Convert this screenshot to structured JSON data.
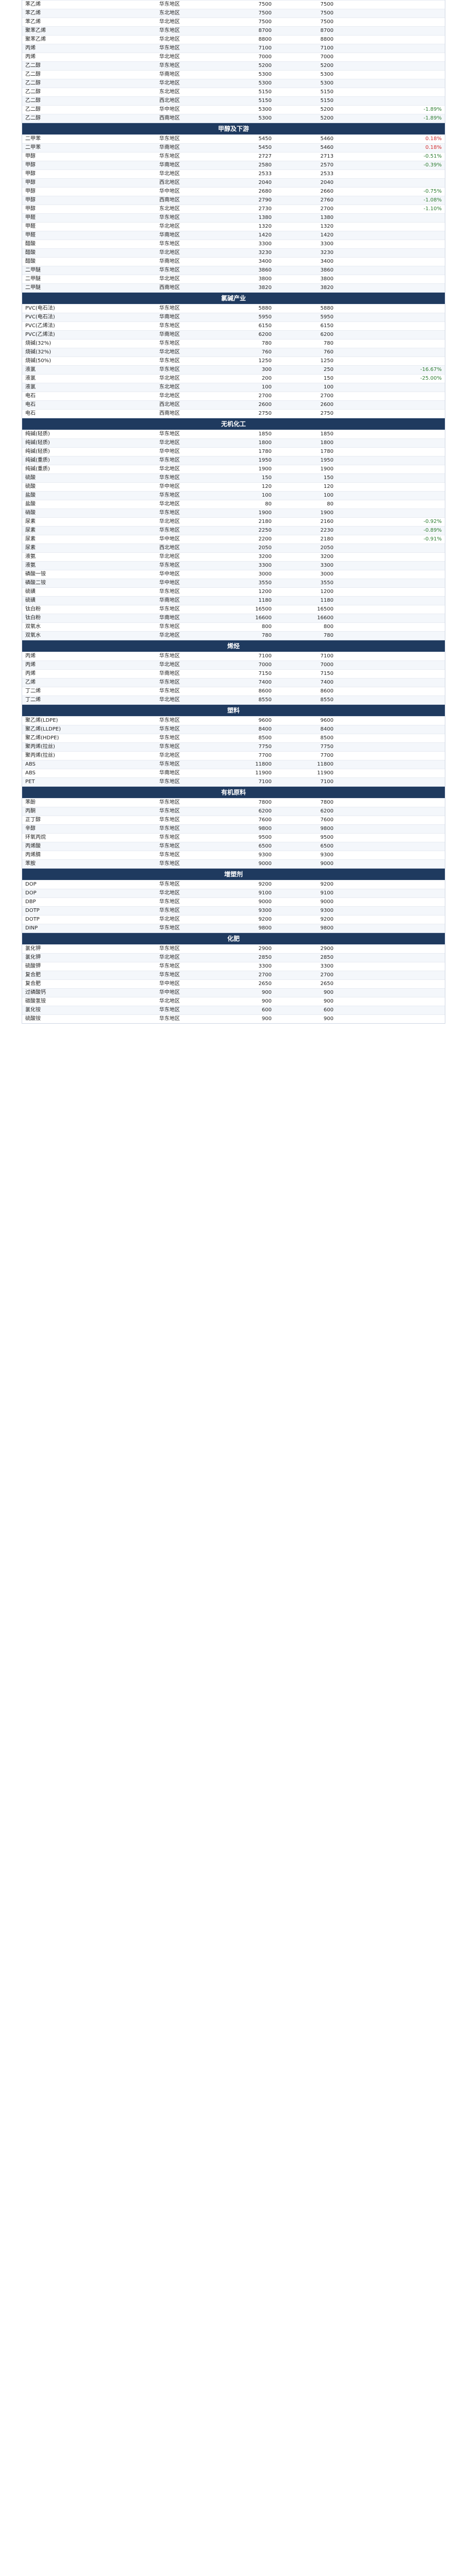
{
  "sections": [
    {
      "title": "",
      "rows": [
        [
          "苯乙烯",
          "华东地区",
          "7500",
          "7500",
          ""
        ],
        [
          "苯乙烯",
          "东北地区",
          "7500",
          "7500",
          ""
        ],
        [
          "苯乙烯",
          "华北地区",
          "7500",
          "7500",
          ""
        ],
        [
          "聚苯乙烯",
          "华东地区",
          "8700",
          "8700",
          ""
        ],
        [
          "聚苯乙烯",
          "华北地区",
          "8800",
          "8800",
          ""
        ],
        [
          "丙烯",
          "华东地区",
          "7100",
          "7100",
          ""
        ],
        [
          "丙烯",
          "华北地区",
          "7000",
          "7000",
          ""
        ],
        [
          "乙二醇",
          "华东地区",
          "5200",
          "5200",
          ""
        ],
        [
          "乙二醇",
          "华南地区",
          "5300",
          "5300",
          ""
        ],
        [
          "乙二醇",
          "华北地区",
          "5300",
          "5300",
          ""
        ],
        [
          "乙二醇",
          "东北地区",
          "5150",
          "5150",
          ""
        ],
        [
          "乙二醇",
          "西北地区",
          "5150",
          "5150",
          ""
        ],
        [
          "乙二醇",
          "华中地区",
          "5300",
          "5200",
          "-1.89%"
        ],
        [
          "乙二醇",
          "西南地区",
          "5300",
          "5200",
          "-1.89%"
        ]
      ]
    },
    {
      "title": "甲醇及下游",
      "rows": [
        [
          "二甲苯",
          "华东地区",
          "5450",
          "5460",
          "0.18%"
        ],
        [
          "二甲苯",
          "华南地区",
          "5450",
          "5460",
          "0.18%"
        ],
        [
          "甲醇",
          "华东地区",
          "2727",
          "2713",
          "-0.51%"
        ],
        [
          "甲醇",
          "华南地区",
          "2580",
          "2570",
          "-0.39%"
        ],
        [
          "甲醇",
          "华北地区",
          "2533",
          "2533",
          ""
        ],
        [
          "甲醇",
          "西北地区",
          "2040",
          "2040",
          ""
        ],
        [
          "甲醇",
          "华中地区",
          "2680",
          "2660",
          "-0.75%"
        ],
        [
          "甲醇",
          "西南地区",
          "2790",
          "2760",
          "-1.08%"
        ],
        [
          "甲醇",
          "东北地区",
          "2730",
          "2700",
          "-1.10%"
        ],
        [
          "甲醛",
          "华东地区",
          "1380",
          "1380",
          ""
        ],
        [
          "甲醛",
          "华北地区",
          "1320",
          "1320",
          ""
        ],
        [
          "甲醛",
          "华南地区",
          "1420",
          "1420",
          ""
        ],
        [
          "醋酸",
          "华东地区",
          "3300",
          "3300",
          ""
        ],
        [
          "醋酸",
          "华北地区",
          "3230",
          "3230",
          ""
        ],
        [
          "醋酸",
          "华南地区",
          "3400",
          "3400",
          ""
        ],
        [
          "二甲醚",
          "华东地区",
          "3860",
          "3860",
          ""
        ],
        [
          "二甲醚",
          "华北地区",
          "3800",
          "3800",
          ""
        ],
        [
          "二甲醚",
          "西南地区",
          "3820",
          "3820",
          ""
        ]
      ]
    },
    {
      "title": "氯碱产业",
      "rows": [
        [
          "PVC(电石法)",
          "华东地区",
          "5880",
          "5880",
          ""
        ],
        [
          "PVC(电石法)",
          "华南地区",
          "5950",
          "5950",
          ""
        ],
        [
          "PVC(乙烯法)",
          "华东地区",
          "6150",
          "6150",
          ""
        ],
        [
          "PVC(乙烯法)",
          "华南地区",
          "6200",
          "6200",
          ""
        ],
        [
          "烧碱(32%)",
          "华东地区",
          "780",
          "780",
          ""
        ],
        [
          "烧碱(32%)",
          "华北地区",
          "760",
          "760",
          ""
        ],
        [
          "烧碱(50%)",
          "华东地区",
          "1250",
          "1250",
          ""
        ],
        [
          "液氯",
          "华东地区",
          "300",
          "250",
          "-16.67%"
        ],
        [
          "液氯",
          "华北地区",
          "200",
          "150",
          "-25.00%"
        ],
        [
          "液氯",
          "东北地区",
          "100",
          "100",
          ""
        ],
        [
          "电石",
          "华北地区",
          "2700",
          "2700",
          ""
        ],
        [
          "电石",
          "西北地区",
          "2600",
          "2600",
          ""
        ],
        [
          "电石",
          "西南地区",
          "2750",
          "2750",
          ""
        ]
      ]
    },
    {
      "title": "无机化工",
      "rows": [
        [
          "纯碱(轻质)",
          "华东地区",
          "1850",
          "1850",
          ""
        ],
        [
          "纯碱(轻质)",
          "华北地区",
          "1800",
          "1800",
          ""
        ],
        [
          "纯碱(轻质)",
          "华中地区",
          "1780",
          "1780",
          ""
        ],
        [
          "纯碱(重质)",
          "华东地区",
          "1950",
          "1950",
          ""
        ],
        [
          "纯碱(重质)",
          "华北地区",
          "1900",
          "1900",
          ""
        ],
        [
          "硫酸",
          "华东地区",
          "150",
          "150",
          ""
        ],
        [
          "硫酸",
          "华中地区",
          "120",
          "120",
          ""
        ],
        [
          "盐酸",
          "华东地区",
          "100",
          "100",
          ""
        ],
        [
          "盐酸",
          "华北地区",
          "80",
          "80",
          ""
        ],
        [
          "硝酸",
          "华东地区",
          "1900",
          "1900",
          ""
        ],
        [
          "尿素",
          "华北地区",
          "2180",
          "2160",
          "-0.92%"
        ],
        [
          "尿素",
          "华东地区",
          "2250",
          "2230",
          "-0.89%"
        ],
        [
          "尿素",
          "华中地区",
          "2200",
          "2180",
          "-0.91%"
        ],
        [
          "尿素",
          "西北地区",
          "2050",
          "2050",
          ""
        ],
        [
          "液氨",
          "华北地区",
          "3200",
          "3200",
          ""
        ],
        [
          "液氨",
          "华东地区",
          "3300",
          "3300",
          ""
        ],
        [
          "磷酸一铵",
          "华中地区",
          "3000",
          "3000",
          ""
        ],
        [
          "磷酸二铵",
          "华中地区",
          "3550",
          "3550",
          ""
        ],
        [
          "硫磺",
          "华东地区",
          "1200",
          "1200",
          ""
        ],
        [
          "硫磺",
          "华南地区",
          "1180",
          "1180",
          ""
        ],
        [
          "钛白粉",
          "华东地区",
          "16500",
          "16500",
          ""
        ],
        [
          "钛白粉",
          "华南地区",
          "16600",
          "16600",
          ""
        ],
        [
          "双氧水",
          "华东地区",
          "800",
          "800",
          ""
        ],
        [
          "双氧水",
          "华北地区",
          "780",
          "780",
          ""
        ]
      ]
    },
    {
      "title": "烯烃",
      "rows": [
        [
          "丙烯",
          "华东地区",
          "7100",
          "7100",
          ""
        ],
        [
          "丙烯",
          "华北地区",
          "7000",
          "7000",
          ""
        ],
        [
          "丙烯",
          "华南地区",
          "7150",
          "7150",
          ""
        ],
        [
          "乙烯",
          "华东地区",
          "7400",
          "7400",
          ""
        ],
        [
          "丁二烯",
          "华东地区",
          "8600",
          "8600",
          ""
        ],
        [
          "丁二烯",
          "华北地区",
          "8550",
          "8550",
          ""
        ]
      ]
    },
    {
      "title": "塑料",
      "rows": [
        [
          "聚乙烯(LDPE)",
          "华东地区",
          "9600",
          "9600",
          ""
        ],
        [
          "聚乙烯(LLDPE)",
          "华东地区",
          "8400",
          "8400",
          ""
        ],
        [
          "聚乙烯(HDPE)",
          "华东地区",
          "8500",
          "8500",
          ""
        ],
        [
          "聚丙烯(拉丝)",
          "华东地区",
          "7750",
          "7750",
          ""
        ],
        [
          "聚丙烯(拉丝)",
          "华北地区",
          "7700",
          "7700",
          ""
        ],
        [
          "ABS",
          "华东地区",
          "11800",
          "11800",
          ""
        ],
        [
          "ABS",
          "华南地区",
          "11900",
          "11900",
          ""
        ],
        [
          "PET",
          "华东地区",
          "7100",
          "7100",
          ""
        ]
      ]
    },
    {
      "title": "有机原料",
      "rows": [
        [
          "苯酚",
          "华东地区",
          "7800",
          "7800",
          ""
        ],
        [
          "丙酮",
          "华东地区",
          "6200",
          "6200",
          ""
        ],
        [
          "正丁醇",
          "华东地区",
          "7600",
          "7600",
          ""
        ],
        [
          "辛醇",
          "华东地区",
          "9800",
          "9800",
          ""
        ],
        [
          "环氧丙烷",
          "华东地区",
          "9500",
          "9500",
          ""
        ],
        [
          "丙烯酸",
          "华东地区",
          "6500",
          "6500",
          ""
        ],
        [
          "丙烯腈",
          "华东地区",
          "9300",
          "9300",
          ""
        ],
        [
          "苯胺",
          "华东地区",
          "9000",
          "9000",
          ""
        ]
      ]
    },
    {
      "title": "增塑剂",
      "rows": [
        [
          "DOP",
          "华东地区",
          "9200",
          "9200",
          ""
        ],
        [
          "DOP",
          "华北地区",
          "9100",
          "9100",
          ""
        ],
        [
          "DBP",
          "华东地区",
          "9000",
          "9000",
          ""
        ],
        [
          "DOTP",
          "华东地区",
          "9300",
          "9300",
          ""
        ],
        [
          "DOTP",
          "华北地区",
          "9200",
          "9200",
          ""
        ],
        [
          "DINP",
          "华东地区",
          "9800",
          "9800",
          ""
        ]
      ]
    },
    {
      "title": "化肥",
      "rows": [
        [
          "氯化钾",
          "华东地区",
          "2900",
          "2900",
          ""
        ],
        [
          "氯化钾",
          "华北地区",
          "2850",
          "2850",
          ""
        ],
        [
          "硫酸钾",
          "华东地区",
          "3300",
          "3300",
          ""
        ],
        [
          "复合肥",
          "华东地区",
          "2700",
          "2700",
          ""
        ],
        [
          "复合肥",
          "华中地区",
          "2650",
          "2650",
          ""
        ],
        [
          "过磷酸钙",
          "华中地区",
          "900",
          "900",
          ""
        ],
        [
          "碳酸氢铵",
          "华北地区",
          "900",
          "900",
          ""
        ],
        [
          "氯化铵",
          "华东地区",
          "600",
          "600",
          ""
        ],
        [
          "硫酸铵",
          "华东地区",
          "900",
          "900",
          ""
        ]
      ]
    }
  ]
}
